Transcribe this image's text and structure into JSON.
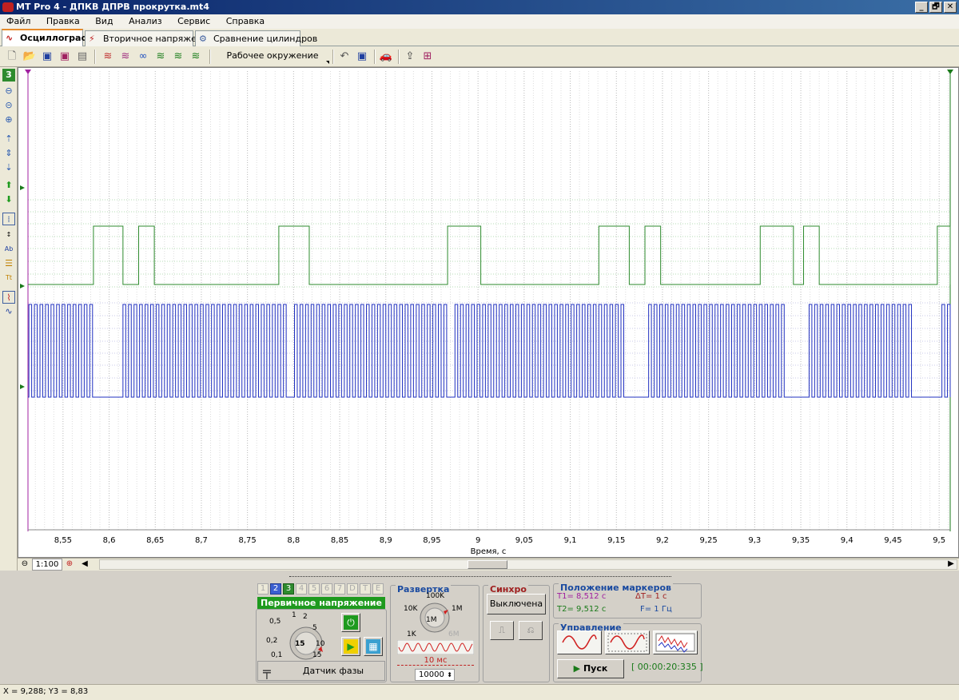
{
  "window": {
    "title": "MT Pro 4 - ДПКВ ДПРВ прокрутка.mt4",
    "controls": [
      "_",
      "🗗",
      "✕"
    ]
  },
  "menu": [
    "Файл",
    "Правка",
    "Вид",
    "Анализ",
    "Сервис",
    "Справка"
  ],
  "tabs": [
    {
      "label": "Осциллограф",
      "icon": "sine-wave-icon",
      "active": true
    },
    {
      "label": "Вторичное напряжение",
      "icon": "secondary-voltage-icon",
      "active": false
    },
    {
      "label": "Сравнение цилиндров",
      "icon": "gear-icon",
      "active": false
    }
  ],
  "toolbar": {
    "workspace_label": "Рабочее окружение",
    "icons": [
      "new-file-icon",
      "open-folder-icon",
      "save-icon",
      "save-as-icon",
      "save-copy-icon",
      "multi-wave-icon",
      "multi-wave-alt-icon",
      "wave-link-icon",
      "wave-check-icon",
      "wave-calc-icon",
      "wave-settings-icon",
      "undo-icon",
      "save-workspace-icon",
      "car-icon",
      "export-icon",
      "marker-icon"
    ]
  },
  "left_tools": {
    "active_channel": "3",
    "icons": [
      "zoom-out-icon",
      "zoom-minus-icon",
      "zoom-plus-icon",
      "scroll-up-icon",
      "scroll-middle-icon",
      "scroll-down-icon",
      "move-up-icon",
      "move-down-icon",
      "cursor-icon",
      "measure-icon",
      "text-icon",
      "list-icon",
      "text-format-icon",
      "graph-icon",
      "spectrum-icon"
    ]
  },
  "chart_data": {
    "type": "line",
    "xlabel": "Время, с",
    "xlim": [
      8.512,
      9.512
    ],
    "x_ticks": [
      "8,55",
      "8,6",
      "8,65",
      "8,7",
      "8,75",
      "8,8",
      "8,85",
      "8,9",
      "8,95",
      "9",
      "9,05",
      "9,1",
      "9,15",
      "9,2",
      "9,25",
      "9,3",
      "9,35",
      "9,4",
      "9,45",
      "9,5"
    ],
    "series": [
      {
        "color": "#2e8b2e",
        "style": "square pulses, low ~360px baseline, high ~283px",
        "segments_high": [
          [
            8.583,
            8.615
          ],
          [
            8.632,
            8.649
          ],
          [
            8.784,
            8.817
          ],
          [
            8.967,
            9.003
          ],
          [
            9.131,
            9.164
          ],
          [
            9.181,
            9.198
          ],
          [
            9.306,
            9.342
          ],
          [
            9.353,
            9.37
          ],
          [
            9.498,
            9.512
          ]
        ]
      },
      {
        "color": "#2030c0",
        "style": "dense square pulse train (crank sensor) with gaps",
        "gaps": [
          [
            8.585,
            8.61
          ],
          [
            8.79,
            8.8
          ],
          [
            8.965,
            8.975
          ],
          [
            9.16,
            9.18
          ],
          [
            9.335,
            9.355
          ],
          [
            9.47,
            9.5
          ]
        ]
      }
    ],
    "grid": true
  },
  "zoombar": {
    "scale": "1:100"
  },
  "channel_panel": {
    "tabs": [
      "1",
      "2",
      "3",
      "4",
      "5",
      "6",
      "7",
      "D",
      "T",
      "E"
    ],
    "name": "Первичное напряжение",
    "knob_labels": [
      "0,5",
      "1",
      "2",
      "5",
      "10",
      "15",
      "0,2",
      "0,1"
    ],
    "knob_value": "15",
    "sensor": "Датчик фазы"
  },
  "sweep_panel": {
    "title": "Развертка",
    "knob_labels": [
      "100K",
      "10K",
      "1M",
      "1K",
      "6M"
    ],
    "knob_value": "1M",
    "time": "10 мс",
    "points": "10000"
  },
  "sync_panel": {
    "title": "Синхро",
    "mode": "Выключена"
  },
  "markers_panel": {
    "title": "Положение маркеров",
    "t1": "T1= 8,512 с",
    "t2": "T2= 9,512 с",
    "dt": "ΔT= 1 с",
    "f": "F= 1 Гц"
  },
  "control_panel": {
    "title": "Управление",
    "start": "Пуск",
    "timer": "[ 00:00:20:335 ]"
  },
  "status": {
    "coords": "X = 9,288; Y3 = 8,83"
  }
}
